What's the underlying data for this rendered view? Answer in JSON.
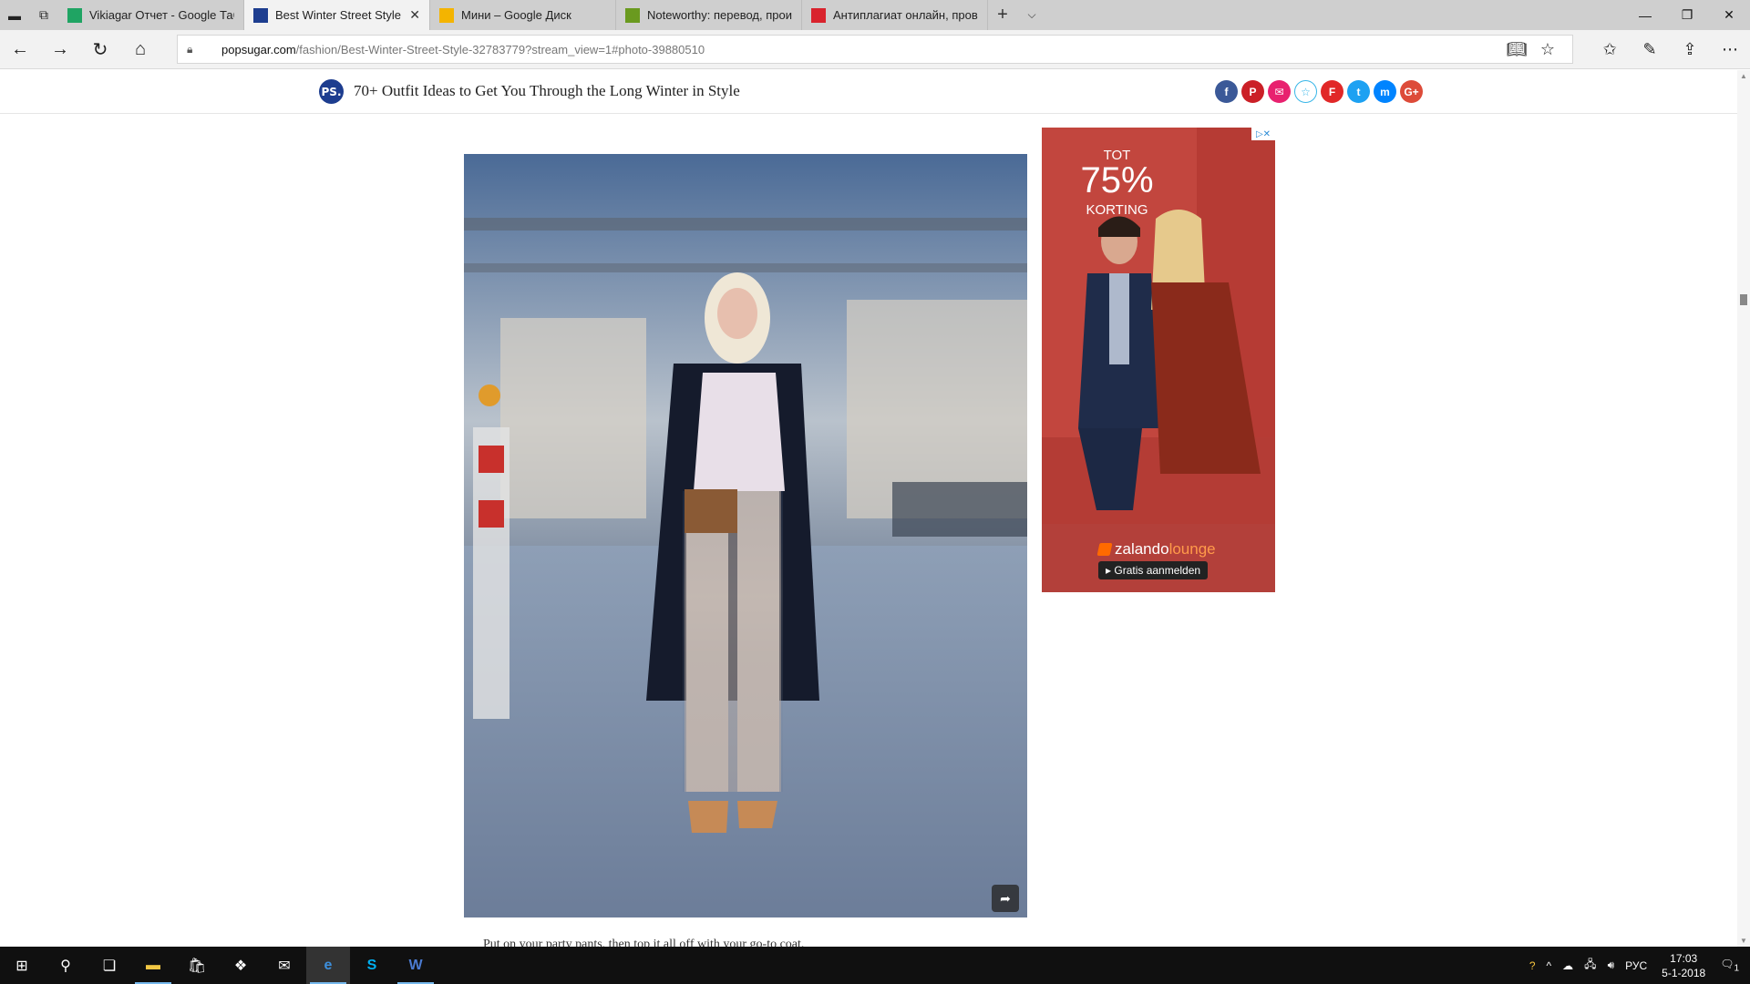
{
  "browser": {
    "tabs": [
      {
        "label": "Vikiagar Отчет - Google Таб",
        "favicon": "sheets-icon",
        "color": "#1fa463",
        "active": false
      },
      {
        "label": "Best Winter Street Style",
        "favicon": "popsugar-icon",
        "color": "#1d3d8f",
        "active": true
      },
      {
        "label": "Мини – Google Диск",
        "favicon": "drive-icon",
        "color": "#f4b400",
        "active": false
      },
      {
        "label": "Noteworthy: перевод, прои",
        "favicon": "dictionary-icon",
        "color": "#6a9a1f",
        "active": false
      },
      {
        "label": "Антиплагиат онлайн, пров",
        "favicon": "antiplagiat-icon",
        "color": "#d9232d",
        "active": false
      }
    ],
    "address": {
      "host": "popsugar.com",
      "path": "/fashion/Best-Winter-Street-Style-32783779?stream_view=1#photo-39880510"
    }
  },
  "page": {
    "logo": "PS.",
    "title": "70+ Outfit Ideas to Get You Through the Long Winter in Style",
    "share_buttons": [
      {
        "name": "facebook",
        "glyph": "f",
        "color": "#3b5998"
      },
      {
        "name": "pinterest",
        "glyph": "P",
        "color": "#cb2027"
      },
      {
        "name": "email",
        "glyph": "✉",
        "color": "#e8216f"
      },
      {
        "name": "favorite",
        "glyph": "☆",
        "color": "#ffffff"
      },
      {
        "name": "flipboard",
        "glyph": "F",
        "color": "#e12828"
      },
      {
        "name": "twitter",
        "glyph": "t",
        "color": "#1da1f2"
      },
      {
        "name": "messenger",
        "glyph": "m",
        "color": "#0084ff"
      },
      {
        "name": "google-plus",
        "glyph": "G+",
        "color": "#dd4b39"
      }
    ],
    "caption": "Put on your party pants, then top it all off with your go-to coat."
  },
  "ad": {
    "tot": "TOT",
    "percent": "75%",
    "korting": "KORTING",
    "brand_a": "zalando",
    "brand_b": "lounge",
    "cta": "▸ Gratis aanmelden"
  },
  "taskbar": {
    "language": "РУС",
    "time": "17:03",
    "date": "5-1-2018",
    "notifications": "1"
  }
}
